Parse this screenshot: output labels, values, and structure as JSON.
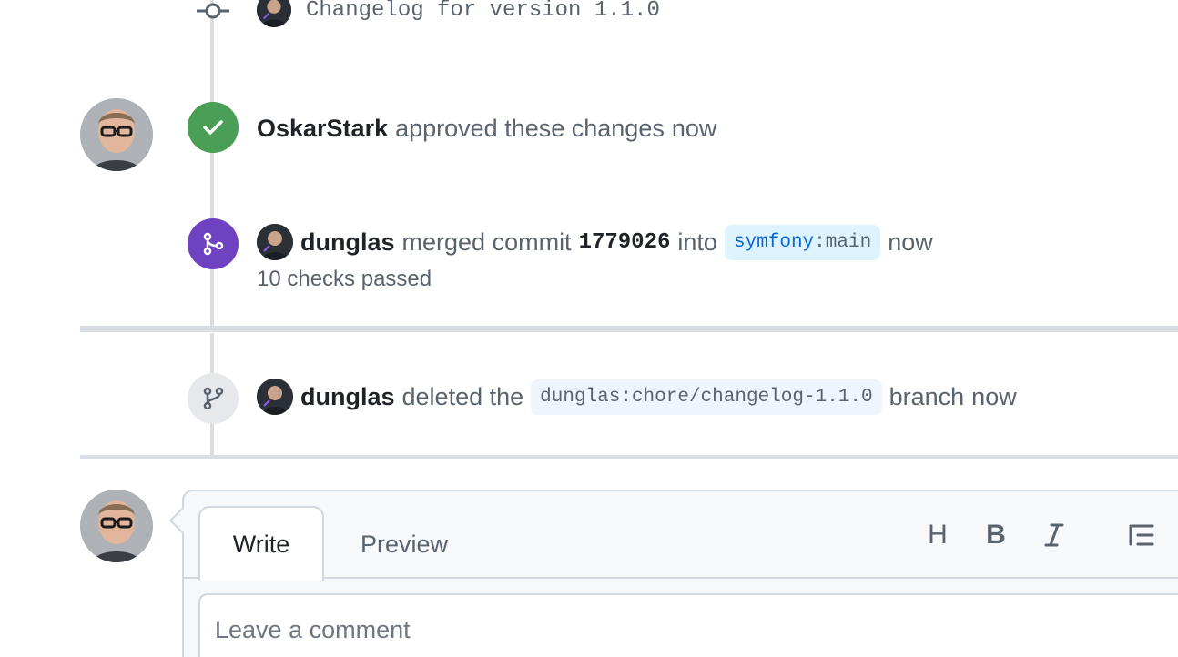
{
  "commit_row": {
    "message": "Changelog for version 1.1.0"
  },
  "approval": {
    "user": "OskarStark",
    "text": "approved these changes",
    "time": "now",
    "badge_color": "#4a9e55"
  },
  "merge": {
    "user": "dunglas",
    "text_before": "merged commit",
    "sha": "1779026",
    "text_into": "into",
    "branch_owner": "symfony",
    "branch_name": "main",
    "time": "now",
    "checks": "10 checks passed",
    "badge_color": "#6f42c1"
  },
  "delete_branch": {
    "user": "dunglas",
    "text_before": "deleted the",
    "branch": "dunglas:chore/changelog-1.1.0",
    "text_after": "branch",
    "time": "now"
  },
  "comment_editor": {
    "tabs": {
      "write": "Write",
      "preview": "Preview"
    },
    "toolbar": {
      "heading": "H",
      "bold": "B",
      "italic": "I"
    },
    "placeholder": "Leave a comment"
  }
}
